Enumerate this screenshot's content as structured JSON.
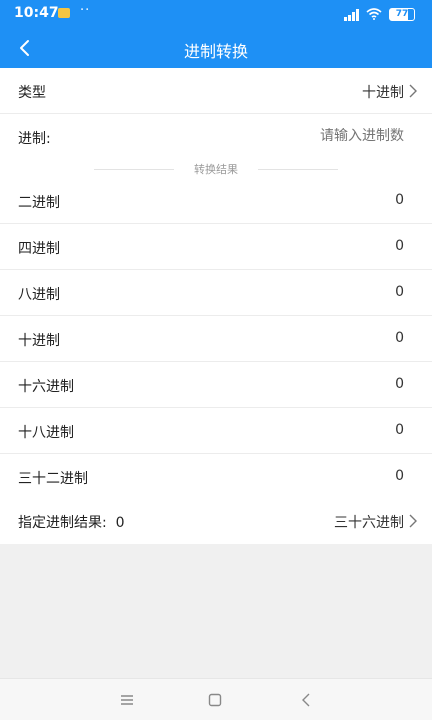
{
  "status_bar": {
    "time": "10:47",
    "dots": "··",
    "battery": "77"
  },
  "app_bar": {
    "title": "进制转换"
  },
  "type_row": {
    "label": "类型",
    "value": "十进制"
  },
  "input_row": {
    "label": "进制:",
    "placeholder": "请输入进制数"
  },
  "divider": {
    "text": "转换结果"
  },
  "results": [
    {
      "label": "二进制",
      "value": "0"
    },
    {
      "label": "四进制",
      "value": "0"
    },
    {
      "label": "八进制",
      "value": "0"
    },
    {
      "label": "十进制",
      "value": "0"
    },
    {
      "label": "十六进制",
      "value": "0"
    },
    {
      "label": "十八进制",
      "value": "0"
    },
    {
      "label": "三十二进制",
      "value": "0"
    }
  ],
  "custom_row": {
    "label": "指定进制结果:  0",
    "value": "三十六进制"
  },
  "colors": {
    "primary": "#1e90f5",
    "background": "#f0f0f0"
  },
  "icons": {
    "back": "chevron-left-icon",
    "chevron": "chevron-right-icon",
    "nav_menu": "menu-icon",
    "nav_home": "home-square-icon",
    "nav_back": "back-triangle-icon"
  }
}
